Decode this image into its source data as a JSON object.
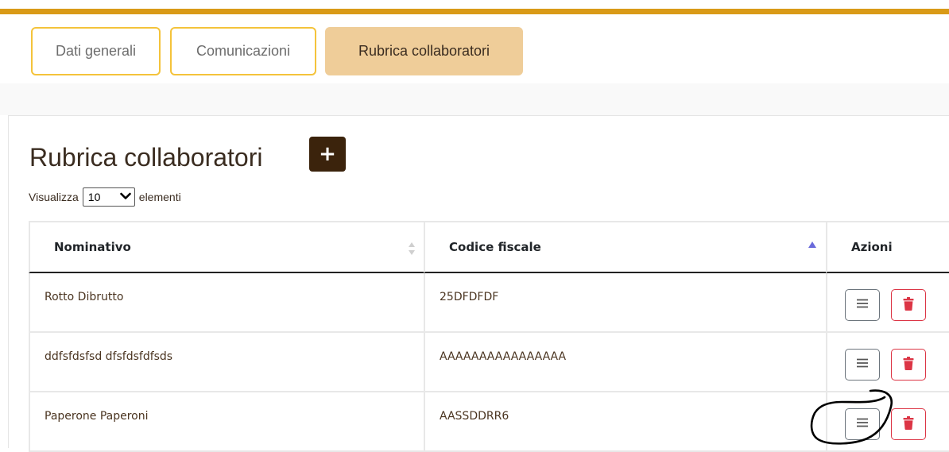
{
  "tabs": [
    {
      "label": "Dati generali",
      "active": false
    },
    {
      "label": "Comunicazioni",
      "active": false
    },
    {
      "label": "Rubrica collaboratori",
      "active": true
    }
  ],
  "page": {
    "title": "Rubrica collaboratori",
    "add_label": "+"
  },
  "length_menu": {
    "prefix": "Visualizza",
    "selected": "10",
    "suffix": "elementi"
  },
  "table": {
    "columns": [
      "Nominativo",
      "Codice fiscale",
      "Azioni"
    ],
    "rows": [
      {
        "nominativo": "Rotto Dibrutto",
        "codice_fiscale": "25DFDFDF"
      },
      {
        "nominativo": "ddfsfdsfsd dfsfdsfdfsds",
        "codice_fiscale": "AAAAAAAAAAAAAAAA"
      },
      {
        "nominativo": "Paperone Paperoni",
        "codice_fiscale": "AASSDDRR6"
      }
    ]
  },
  "icons": {
    "menu": "menu-lines-icon",
    "delete": "trash-icon",
    "sort": "sort-icon",
    "sort_asc": "sort-asc-icon"
  },
  "colors": {
    "accent": "#d99a17",
    "tab_border": "#f4c33b",
    "tab_active": "#efcd99",
    "add_button": "#3b230c",
    "delete": "#dc3545"
  }
}
